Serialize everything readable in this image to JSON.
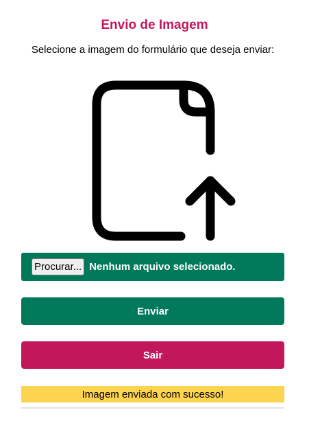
{
  "page": {
    "title": "Envio de Imagem",
    "instruction": "Selecione a imagem do formulário que deseja enviar:"
  },
  "upload_icon": {
    "icon": "file-upload-icon"
  },
  "file_input": {
    "browse_label": "Procurar...",
    "status_text": "Nenhum arquivo selecionado."
  },
  "actions": {
    "send_label": "Enviar",
    "exit_label": "Sair"
  },
  "message": {
    "text": "Imagem enviada com sucesso!"
  },
  "colors": {
    "accent_pink": "#c2185b",
    "primary_green": "#00785a",
    "success_yellow": "#fdd44f"
  }
}
